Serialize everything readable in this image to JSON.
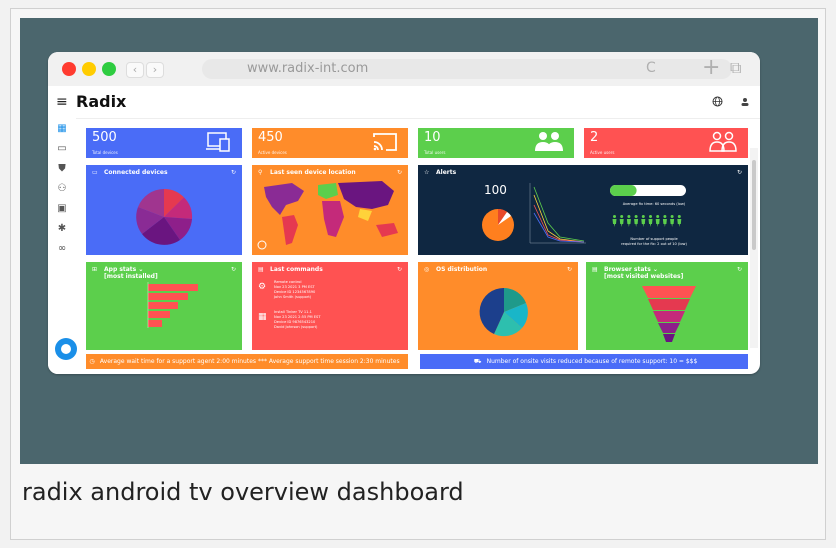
{
  "caption": "radix android tv overview dashboard",
  "browser": {
    "url": "www.radix-int.com",
    "back": "‹",
    "forward": "›",
    "reload": "C",
    "new_tab": "+",
    "tabs_icon": "⧉"
  },
  "app": {
    "brand": "Radix",
    "menu_icon": "≡",
    "globe_icon": "globe-icon",
    "user_icon": "user-icon"
  },
  "sidebar": [
    {
      "icon": "dashboard-icon",
      "glyph": "▦"
    },
    {
      "icon": "devices-icon",
      "glyph": "▭"
    },
    {
      "icon": "shield-icon",
      "glyph": "⛊"
    },
    {
      "icon": "users-icon",
      "glyph": "⚇"
    },
    {
      "icon": "save-icon",
      "glyph": "▣"
    },
    {
      "icon": "settings-icon",
      "glyph": "✱"
    },
    {
      "icon": "link-icon",
      "glyph": "∞"
    }
  ],
  "kpis": [
    {
      "value": "500",
      "label": "Total devices",
      "color": "#4a6cf7",
      "icon": "devices-icon"
    },
    {
      "value": "450",
      "label": "Active devices",
      "color": "#ff8c2a",
      "icon": "cast-icon"
    },
    {
      "value": "10",
      "label": "Total users",
      "color": "#5ccf4c",
      "icon": "users-icon"
    },
    {
      "value": "2",
      "label": "Active users",
      "color": "#ff5252",
      "icon": "users-outline-icon"
    }
  ],
  "cards": {
    "connected": {
      "title": "Connected devices",
      "color": "#4a6cf7"
    },
    "location": {
      "title": "Last seen device location",
      "color": "#ff8c2a"
    },
    "alerts": {
      "title": "Alerts",
      "color": "#0f2741",
      "value": "100",
      "fix_text": "Average fix time: 60 seconds (low)",
      "support_text": "Number of support people",
      "support_text2": "required for the fix: 2 out of 10 (low)",
      "progress": 0.35
    },
    "appstats": {
      "title": "App stats ⌄",
      "subtitle": "[most installed]",
      "color": "#5ccf4c"
    },
    "commands": {
      "title": "Last commands",
      "color": "#ff5252",
      "items": [
        {
          "lines": [
            "Remote control",
            "Nov 23 2021 3 PM EST",
            "Device ID 1234567890",
            "John Smith (support)"
          ]
        },
        {
          "lines": [
            "Install Tinker TV 11.1",
            "Nov 23 2021 2:55 PM EST",
            "Device ID 9876543210",
            "David Johnson (support)"
          ]
        }
      ]
    },
    "os": {
      "title": "OS distribution",
      "color": "#ff8c2a"
    },
    "browser": {
      "title": "Browser stats ⌄",
      "subtitle": "[most visited websites]",
      "color": "#5ccf4c"
    }
  },
  "tickers": {
    "left": "Average wait time for a support agent 2:00 minutes *** Average support time session 2:30 minutes",
    "right": "Number of onsite visits reduced because of remote support: 10 = $$$",
    "left_color": "#ff8c2a",
    "right_color": "#4a6cf7"
  }
}
